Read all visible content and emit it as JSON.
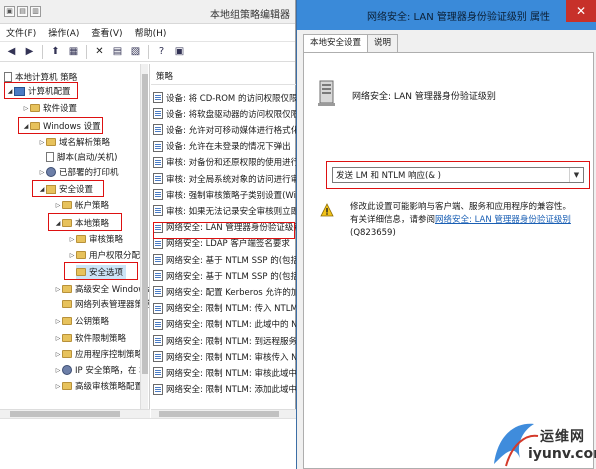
{
  "gpe": {
    "title": "本地组策略编辑器",
    "menu": [
      "文件(F)",
      "操作(A)",
      "查看(V)",
      "帮助(H)"
    ],
    "tree": {
      "root": "本地计算机 策略",
      "computer_config": "计算机配置",
      "software_settings": "软件设置",
      "windows_settings": "Windows 设置",
      "dns_policy": "域名解析策略",
      "scripts": "脚本(启动/关机)",
      "deployed_printers": "已部署的打印机",
      "security_settings": "安全设置",
      "account_policy": "帐户策略",
      "local_policy": "本地策略",
      "audit_policy": "审核策略",
      "user_rights": "用户权限分配",
      "security_options": "安全选项",
      "advanced_firewall": "高级安全 Windows",
      "network_list": "网络列表管理器策略",
      "public_key": "公钥策略",
      "software_restriction": "软件限制策略",
      "app_control": "应用程序控制策略",
      "ip_security": "IP 安全策略，在 本",
      "advanced_audit": "高级审核策略配置"
    },
    "list_header": "策略",
    "policies": [
      "设备: 将 CD-ROM 的访问权限仅限于",
      "设备: 将软盘驱动器的访问权限仅限于",
      "设备: 允许对可移动媒体进行格式化并",
      "设备: 允许在未登录的情况下弹出",
      "审核: 对备份和还原权限的使用进行审",
      "审核: 对全局系统对象的访问进行审核",
      "审核: 强制审核策略子类别设置(Wind",
      "审核: 如果无法记录安全审核则立即关",
      "网络安全: LAN 管理器身份验证级别",
      "网络安全: LDAP 客户端签名要求",
      "网络安全: 基于 NTLM SSP 的(包括安",
      "网络安全: 基于 NTLM SSP 的(包括安",
      "网络安全: 配置 Kerberos 允许的加密",
      "网络安全: 限制 NTLM: 传入 NTLM 流",
      "网络安全: 限制 NTLM: 此域中的 NTL",
      "网络安全: 限制 NTLM: 到远程服务器",
      "网络安全: 限制 NTLM: 审核传入 NTL",
      "网络安全: 限制 NTLM: 审核此域中的",
      "网络安全: 限制 NTLM: 添加此域中的"
    ]
  },
  "dialog": {
    "title": "网络安全: LAN 管理器身份验证级别 属性",
    "tabs": [
      "本地安全设置",
      "说明"
    ],
    "policy_name": "网络安全: LAN 管理器身份验证级别",
    "selected_value": "发送 LM 和 NTLM 响应(& )",
    "warning_line1": "修改此设置可能影响与客户端、服务和应用程序的兼容性。",
    "warning_line2_prefix": "有关详细信息，请参阅",
    "warning_link": "网络安全: LAN 管理器身份验证级别",
    "warning_kb": "(Q823659)"
  },
  "watermark": {
    "cn": "运维网",
    "en": "iyunv.com"
  }
}
